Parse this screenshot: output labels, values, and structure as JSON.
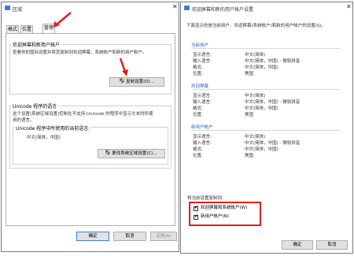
{
  "left": {
    "title": "区域",
    "tabs": [
      "格式",
      "位置",
      "管理"
    ],
    "welcome_group_title": "欢迎屏幕和新用户帐户",
    "welcome_text": "查看你的国际设置并将其复制到欢迎屏幕、系统帐户和新的用户帐户。",
    "copy_button": "复制设置(O)...",
    "unicode_title": "Unicode 程序的语言",
    "unicode_text_1": "这个设置(系统区域设置)控制在不支持 Unicode 的程序中显示文本时所使",
    "unicode_text_2": "用的语言。",
    "current_lang_label": "Unicode 程序中所使用的当前语言:",
    "current_lang_value": "中文(简体，中国)",
    "change_locale_button": "更改系统区域设置(C)...",
    "ok_button": "确定",
    "cancel_button": "取消",
    "apply_button": "应用(A)"
  },
  "right": {
    "title": "欢迎屏幕和新的用户帐户设置",
    "intro": "下面显示的是当前用户、欢迎屏幕(系统帐户)和新的用户帐户的设置(S)。",
    "sections": [
      {
        "heading": "当前用户",
        "rows": [
          {
            "k": "显示语言:",
            "v": "中文(简体)"
          },
          {
            "k": "输入语言:",
            "v": "中文(简体，中国) - 微软拼音"
          },
          {
            "k": "格式:",
            "v": "中文(简体，中国)"
          },
          {
            "k": "位置:",
            "v": "美国"
          }
        ]
      },
      {
        "heading": "欢迎屏幕",
        "rows": [
          {
            "k": "显示语言:",
            "v": "中文(简体)"
          },
          {
            "k": "输入语言:",
            "v": "中文(简体，中国) - 微软拼音"
          },
          {
            "k": "格式:",
            "v": "中文(简体，中国)"
          },
          {
            "k": "位置:",
            "v": "美国"
          }
        ]
      },
      {
        "heading": "新用户帐户",
        "rows": [
          {
            "k": "显示语言:",
            "v": "中文(简体)"
          },
          {
            "k": "输入语言:",
            "v": "中文(简体，中国) - 微软拼音"
          },
          {
            "k": "格式:",
            "v": "中文(简体，中国)"
          },
          {
            "k": "位置:",
            "v": "美国"
          }
        ]
      }
    ],
    "copy_label": "将当前设置复制到:",
    "check1": "欢迎屏幕和系统帐户(W)",
    "check2": "新用户帐户(N)",
    "ok_button": "确定",
    "cancel_button": "取消"
  },
  "colors": {
    "accent_red": "#e1201b",
    "section_blue": "#2a62b8"
  }
}
